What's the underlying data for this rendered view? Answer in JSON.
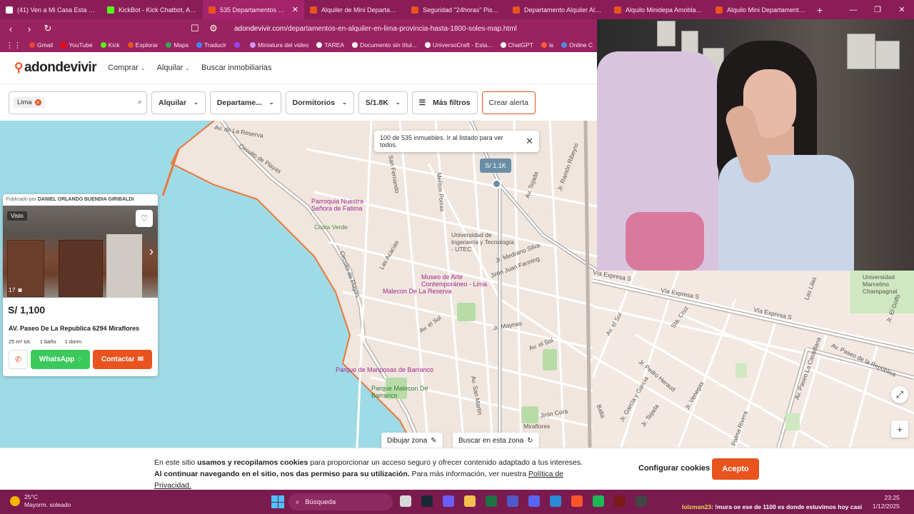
{
  "browser": {
    "tabs": [
      {
        "label": "(41) Ven a Mi Casa Esta Na",
        "color": "#ffffff",
        "active": false
      },
      {
        "label": "KickBot - Kick Chatbot, Alerts,",
        "color": "#53fc18",
        "active": false
      },
      {
        "label": "535 Departamentos en alq",
        "color": "#e8531e",
        "active": true
      },
      {
        "label": "Alquiler de Mini Departamento",
        "color": "#e8531e",
        "active": false
      },
      {
        "label": "Seguridad \"24horas\" Piscina, G",
        "color": "#e8531e",
        "active": false
      },
      {
        "label": "Departamento Alquiler Alt Cdr",
        "color": "#e8531e",
        "active": false
      },
      {
        "label": "Alquilo Minidepa Amoblado e",
        "color": "#e8531e",
        "active": false
      },
      {
        "label": "Alquilo Mini Departamento 1 D",
        "color": "#e8531e",
        "active": false
      }
    ],
    "url_domain": "adondevivir.com",
    "url_path": "/departamentos-en-alquiler-en-lima-provincia-hasta-1800-soles-map.html",
    "bookmarks": [
      {
        "label": "Gmail",
        "color": "#ea4335"
      },
      {
        "label": "YouTube",
        "color": "#ff0000"
      },
      {
        "label": "Kick",
        "color": "#53fc18"
      },
      {
        "label": "Explorar",
        "color": "#e8531e"
      },
      {
        "label": "Maps",
        "color": "#34a853"
      },
      {
        "label": "Traducir",
        "color": "#4285f4"
      },
      {
        "label": "",
        "color": "#9146ff"
      },
      {
        "label": "Miniatura del video",
        "color": "#c89bff"
      },
      {
        "label": "TAREA",
        "color": "#ffffff"
      },
      {
        "label": "Documento sin títul...",
        "color": "#ffffff"
      },
      {
        "label": "UniversoCraft - Esta...",
        "color": "#ffffff"
      },
      {
        "label": "ChatGPT",
        "color": "#ffffff"
      },
      {
        "label": "is",
        "color": "#ff5b2e"
      },
      {
        "label": "Online C",
        "color": "#4a90e2"
      }
    ]
  },
  "site": {
    "logo": "adondevivir",
    "nav": [
      {
        "label": "Comprar"
      },
      {
        "label": "Alquilar"
      },
      {
        "label": "Buscar inmobiliarias"
      }
    ]
  },
  "filters": {
    "location_chip": "Lima",
    "operation": "Alquilar",
    "property_type": "Departame...",
    "rooms": "Dormitorios",
    "price": "S/1.8K",
    "more_filters": "Más filtros",
    "create_alert": "Crear alerta"
  },
  "map": {
    "tooltip": "100 de 535 inmuebles. Ir al listado para ver todos.",
    "price_tag": "S/ 1.1K",
    "labels": {
      "circuito_playas": "Circuito de Playas",
      "circuito_playas2": "Circuito de Playas",
      "costa_verde": "Costa Verde",
      "parroquia": "Parroquia Nuestra Señora de Fatima",
      "universidad": "Universidad de Ingeniería y Tecnología - UTEC",
      "museo": "Museo de Arte Contemporáneo - Lima",
      "malecon_reserva": "Malecon De La Reserva",
      "mariposas": "Parque de Mariposas de Barranco",
      "parque_malecon": "Parque Malecon De Barranco",
      "av_reserva": "Av. de La Reserva",
      "medrano": "Jr. Medrano Silva",
      "fanning": "Jirón Juan Fanning",
      "maynas": "Jr. Maynas",
      "av_sol": "Av. el Sol",
      "av_sol2": "Av. el Sol",
      "miraflores": "Miraflores",
      "jiron_cora": "Jirón Cora",
      "san_martin": "Av. San Martín",
      "tejada": "Av. Tejada",
      "ramon": "Jr. Ramón Ribeyro",
      "melitón": "Meliton Porras",
      "san_fernando": "San Fernando",
      "las_acacias": "Las Acacias"
    },
    "draw_zone": "Dibujar zona",
    "search_zone": "Buscar en esta zona"
  },
  "listing": {
    "publisher_prefix": "Publicado por",
    "publisher": "DANIEL ORLANDO BUENDIA GIRIBALDI",
    "seen_badge": "Visto",
    "photo_count": "17",
    "price": "S/ 1,100",
    "address": "AV. Paseo De La Republica 6294 Miraflores",
    "area": "25 m² tot.",
    "baths": "1 baño",
    "bedrooms": "1 dorm.",
    "whatsapp": "WhatsApp",
    "contact": "Contactar"
  },
  "map2": {
    "labels": {
      "via_expresa": "Vía Expresa S",
      "via_expresa2": "Vía Expresa S",
      "via_expresa3": "Vía Expresa S",
      "av_sol": "Av. el Sol",
      "universidad": "Universidad Marcelino Champagnat",
      "pedro_heraud": "Jr. Pedro Heraud",
      "garcia": "Jr. García y García",
      "tejada": "Jr. Tejada",
      "venegas": "Jr. Venegas",
      "castellana": "Av. Paseo La Castellana",
      "repub": "Av. Paseo de la República",
      "palma": "Palma Rivera",
      "balta": "Balta",
      "las_lilas": "Las Lilas",
      "el_golfo": "Jr. El Golfo",
      "sta_cruz": "Sta. Cruz"
    }
  },
  "cookie": {
    "t1": "En este sitio ",
    "b1": "usamos y recopilamos cookies",
    "t2": " para proporcionar un acceso seguro y ofrecer contenido adaptado a tus intereses. ",
    "b2": "Al continuar navegando en el sitio, nos das permiso para su utilización.",
    "t3": " Para más información, ver nuestra ",
    "link": "Política de Privacidad.",
    "configure": "Configurar cookies",
    "accept": "Acepto"
  },
  "taskbar": {
    "temp": "25°C",
    "weather": "Mayorm. soleado",
    "search": "Búsqueda",
    "chat_user": "lolzman23",
    "chat_msg": ": !mura oe ese de 1100 es donde estuvimos hoy casi",
    "time": "23:25",
    "date": "1/12/2025"
  }
}
